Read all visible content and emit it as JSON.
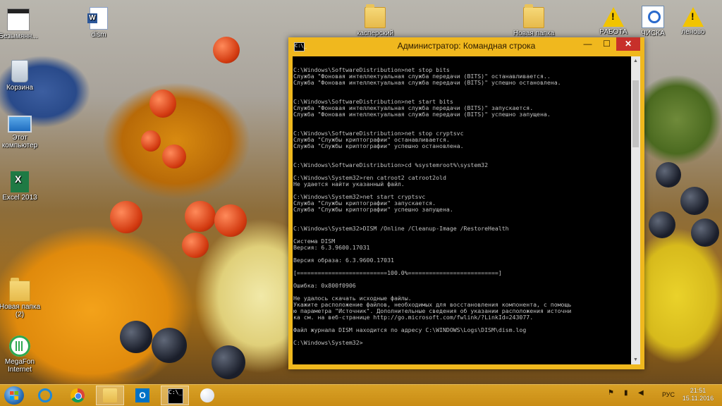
{
  "desktop": {
    "icons": [
      {
        "label": "Безымянн...",
        "icon": "image-file-icon"
      },
      {
        "label": "dism",
        "icon": "word-document-icon"
      },
      {
        "label": "касперский",
        "icon": "folder-icon"
      },
      {
        "label": "Новая папка",
        "icon": "folder-icon"
      },
      {
        "label": "РАБОТА",
        "icon": "warning-icon"
      },
      {
        "label": "ЧИСКА",
        "icon": "scan-icon"
      },
      {
        "label": "леново",
        "icon": "warning-icon"
      },
      {
        "label": "Корзина",
        "icon": "recycle-bin-icon"
      },
      {
        "label": "Этот компьютер",
        "icon": "computer-icon"
      },
      {
        "label": "Excel 2013",
        "icon": "excel-icon"
      },
      {
        "label": "Новая папка (2)",
        "icon": "folder-icon"
      },
      {
        "label": "MegaFon Internet",
        "icon": "megafon-icon"
      }
    ]
  },
  "console_window": {
    "title": "Администратор: Командная строка",
    "icon_text": "C:\\_",
    "minimize": "—",
    "maximize": "☐",
    "close": "✕",
    "output": "C:\\Windows\\SoftwareDistribution>net stop bits\nСлужба \"Фоновая интеллектуальная служба передачи (BITS)\" останавливается..\nСлужба \"Фоновая интеллектуальная служба передачи (BITS)\" успешно остановлена.\n\n\nC:\\Windows\\SoftwareDistribution>net start bits\nСлужба \"Фоновая интеллектуальная служба передачи (BITS)\" запускается.\nСлужба \"Фоновая интеллектуальная служба передачи (BITS)\" успешно запущена.\n\n\nC:\\Windows\\SoftwareDistribution>net stop cryptsvc\nСлужба \"Службы криптографии\" останавливается.\nСлужба \"Службы криптографии\" успешно остановлена.\n\n\nC:\\Windows\\SoftwareDistribution>cd %systemroot%\\system32\n\nC:\\Windows\\System32>ren catroot2 catroot2old\nНе удается найти указанный файл.\n\nC:\\Windows\\System32>net start cryptsvc\nСлужба \"Службы криптографии\" запускается.\nСлужба \"Службы криптографии\" успешно запущена.\n\n\nC:\\Windows\\System32>DISM /Online /Cleanup-Image /RestoreHealth\n\nСистема DISM\nВерсия: 6.3.9600.17031\n\nВерсия образа: 6.3.9600.17031\n\n[==========================100.0%==========================]\n\nОшибка: 0x800f0906\n\nНе удалось скачать исходные файлы.\nУкажите расположение файлов, необходимых для восстановления компонента, с помощь\nю параметра \"Источник\". Дополнительные сведения об указании расположения источни\nка см. на веб-странице http://go.microsoft.com/fwlink/?LinkId=243077.\n\nФайл журнала DISM находится по адресу C:\\WINDOWS\\Logs\\DISM\\dism.log\n\nC:\\Windows\\System32>"
  },
  "taskbar": {
    "items": [
      {
        "name": "internet-explorer",
        "icon": "internet-explorer-icon",
        "active": false
      },
      {
        "name": "chrome",
        "icon": "chrome-icon",
        "active": false
      },
      {
        "name": "file-explorer",
        "icon": "folder-icon",
        "active": true
      },
      {
        "name": "outlook",
        "icon": "outlook-icon",
        "active": false,
        "glyph": "O"
      },
      {
        "name": "command-prompt",
        "icon": "command-prompt-icon",
        "active": true,
        "glyph": "C:\\_"
      },
      {
        "name": "paint",
        "icon": "paint-icon",
        "active": false
      }
    ],
    "tray": {
      "language": "РУС",
      "time": "21:51",
      "date": "15.11.2016",
      "flag_glyph": "⚑",
      "network_glyph": "▮",
      "volume_glyph": "◀"
    }
  }
}
